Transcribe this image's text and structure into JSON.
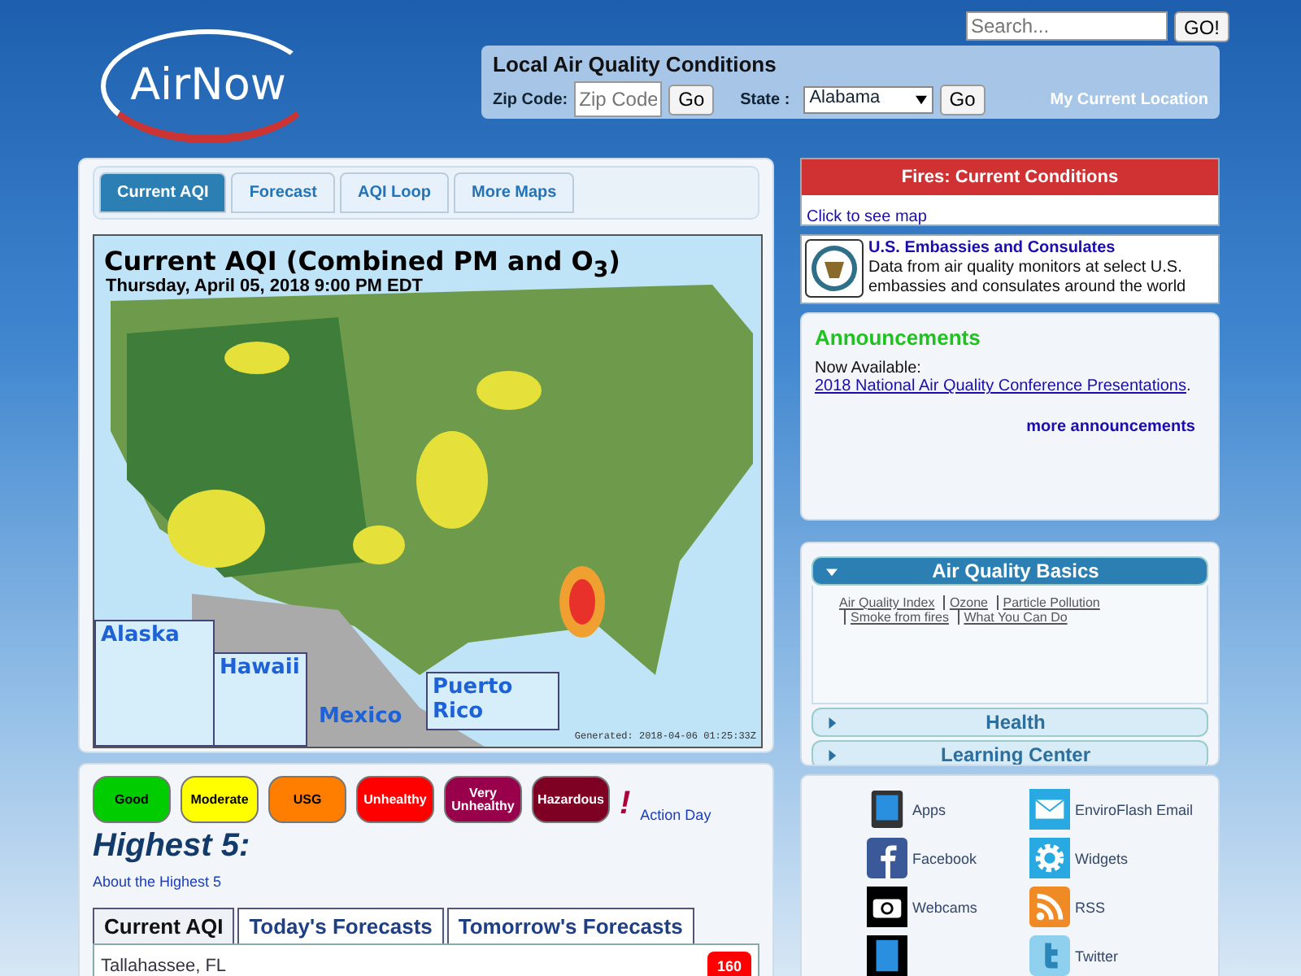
{
  "header": {
    "logo": "AirNow",
    "search": {
      "placeholder": "Search...",
      "button": "GO!"
    },
    "local": {
      "title": "Local Air Quality Conditions",
      "zip_label": "Zip Code:",
      "zip_placeholder": "Zip Code",
      "zip_go": "Go",
      "state_label": "State :",
      "state_value": "Alabama",
      "state_go": "Go",
      "my_location": "My Current Location"
    }
  },
  "map_tabs": [
    {
      "label": "Current AQI",
      "selected": true
    },
    {
      "label": "Forecast",
      "selected": false
    },
    {
      "label": "AQI Loop",
      "selected": false
    },
    {
      "label": "More Maps",
      "selected": false
    }
  ],
  "map": {
    "title": "Current AQI (Combined PM and O$_{3}$)",
    "date": "Thursday, April 05, 2018 9:00 PM EDT",
    "insets": [
      "Alaska",
      "Hawaii",
      "Puerto Rico"
    ],
    "mexico": "Mexico",
    "generated": "Generated: 2018-04-06 01:25:33Z"
  },
  "legend": [
    {
      "label": "Good",
      "color": "#00cc00"
    },
    {
      "label": "Moderate",
      "color": "#ffff00"
    },
    {
      "label": "USG",
      "color": "#ff7e00"
    },
    {
      "label": "Unhealthy",
      "color": "#ff0000"
    },
    {
      "label": "Very Unhealthy",
      "color": "#99004c"
    },
    {
      "label": "Hazardous",
      "color": "#7e0023"
    }
  ],
  "action_day": {
    "mark": "!",
    "label": "Action Day"
  },
  "highest": {
    "title": "Highest 5:",
    "about": "About the Highest 5",
    "tabs": [
      {
        "label": "Current AQI",
        "selected": true
      },
      {
        "label": "Today's Forecasts",
        "selected": false
      },
      {
        "label": "Tomorrow's Forecasts",
        "selected": false
      }
    ],
    "rows": [
      {
        "city": "Tallahassee, FL",
        "value": "160",
        "color": "#ff0000"
      }
    ]
  },
  "fires": {
    "title": "Fires: Current Conditions",
    "link": "Click to see map"
  },
  "embassies": {
    "link": "U.S. Embassies and Consulates",
    "text": "Data from air quality monitors at select U.S. embassies and consulates around the world"
  },
  "announcements": {
    "title": "Announcements",
    "prefix": "Now Available:",
    "link": "2018 National Air Quality Conference Presentations",
    "suffix": ".",
    "more": "more announcements"
  },
  "basics": [
    {
      "title": "Air Quality Basics",
      "expanded": true,
      "links": [
        "Air Quality Index",
        "Ozone",
        "Particle Pollution",
        "Smoke from fires",
        "What You Can Do"
      ]
    },
    {
      "title": "Health",
      "expanded": false
    },
    {
      "title": "Learning Center",
      "expanded": false
    }
  ],
  "social": [
    {
      "label": "Apps",
      "kind": "tablet"
    },
    {
      "label": "EnviroFlash Email",
      "kind": "mail"
    },
    {
      "label": "Facebook",
      "kind": "facebook"
    },
    {
      "label": "Widgets",
      "kind": "gear"
    },
    {
      "label": "Webcams",
      "kind": "camera"
    },
    {
      "label": "RSS",
      "kind": "rss"
    },
    {
      "kind": "film"
    },
    {
      "label": "Twitter",
      "kind": "twitter"
    }
  ]
}
